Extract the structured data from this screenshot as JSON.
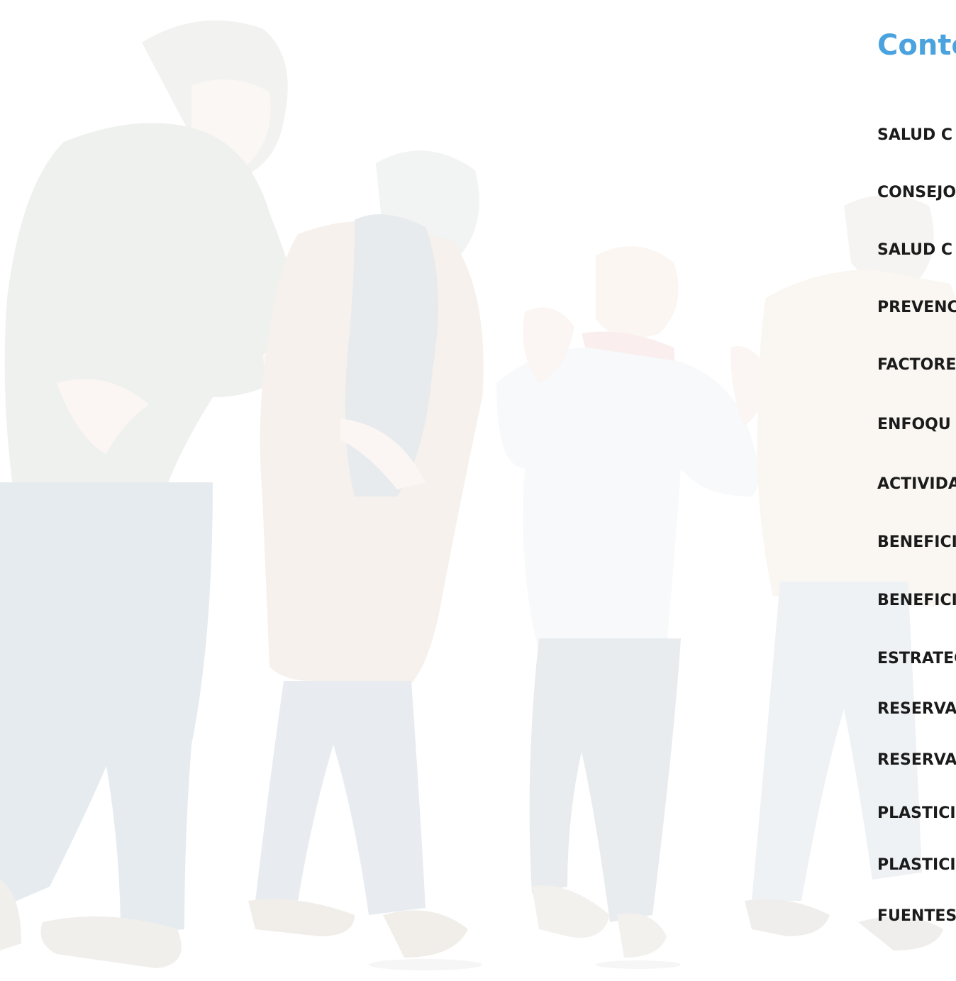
{
  "toc": {
    "title": "Conte",
    "items": [
      "SALUD C",
      "CONSEJO",
      "SALUD C",
      "PREVENC",
      "FACTORE",
      "ENFOQU",
      "ACTIVIDA",
      "BENEFICI",
      "BENEFICI",
      "ESTRATEG",
      "RESERVA",
      "RESERVA",
      "PLASTICI",
      "PLASTICI",
      "FUENTES"
    ]
  },
  "colors": {
    "title": "#4aa3df",
    "item_text": "#1b1b1b",
    "background": "#ffffff"
  }
}
